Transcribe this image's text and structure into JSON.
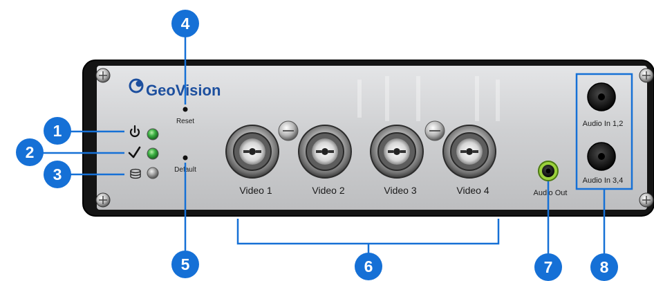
{
  "brand": {
    "logo_text": "GeoVision"
  },
  "panel": {
    "reset_label": "Reset",
    "default_label": "Default",
    "video_labels": [
      "Video 1",
      "Video 2",
      "Video 3",
      "Video 4"
    ],
    "audio_out_label": "Audio Out",
    "audio_in_labels": [
      "Audio In 1,2",
      "Audio In 3,4"
    ]
  },
  "indicators": [
    {
      "icon": "power-icon",
      "led_color": "#3cb043"
    },
    {
      "icon": "checkmark-icon",
      "led_color": "#3cb043"
    },
    {
      "icon": "hdd-icon",
      "led_color": "#a8a8a8"
    }
  ],
  "callouts": [
    "1",
    "2",
    "3",
    "4",
    "5",
    "6",
    "7",
    "8"
  ],
  "colors": {
    "callout_blue": "#1570d6",
    "panel_silver": "#d2d3d5",
    "chassis": "#141414"
  }
}
